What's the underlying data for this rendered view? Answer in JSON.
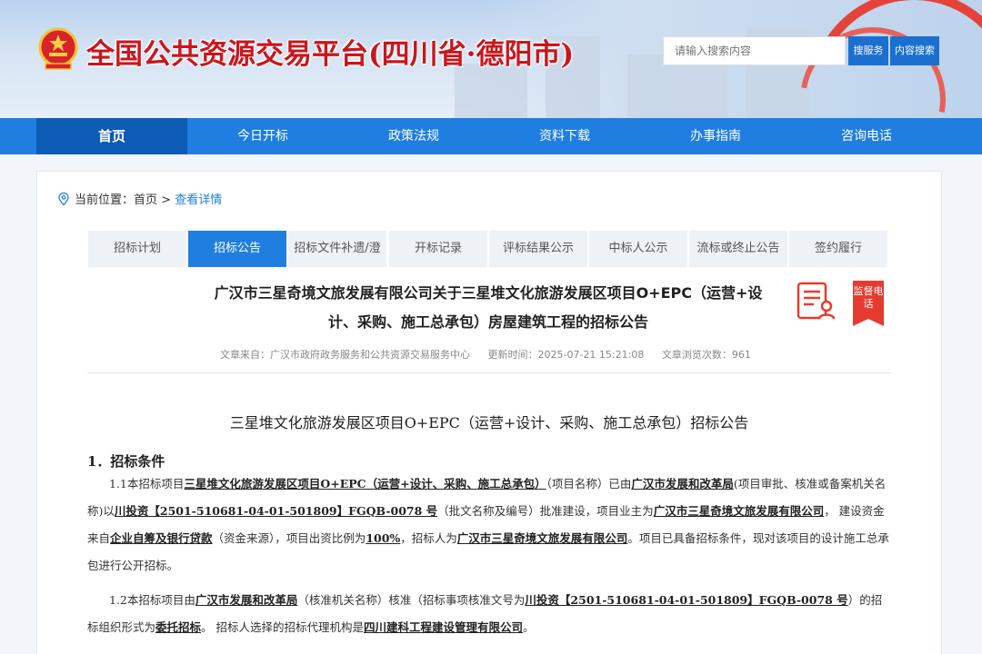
{
  "site": {
    "title": "全国公共资源交易平台(四川省·德阳市)",
    "search_placeholder": "请输入搜索内容",
    "search_service_label": "搜服务",
    "search_content_label": "内容搜索"
  },
  "nav": {
    "items": [
      "首页",
      "今日开标",
      "政策法规",
      "资料下载",
      "办事指南",
      "咨询电话"
    ],
    "active_index": 0
  },
  "breadcrumb": {
    "prefix": "当前位置：",
    "home": "首页",
    "separator": " > ",
    "current": "查看详情"
  },
  "tabs": {
    "items": [
      "招标计划",
      "招标公告",
      "招标文件补遗/澄",
      "开标记录",
      "评标结果公示",
      "中标人公示",
      "流标或终止公告",
      "签约履行"
    ],
    "active_index": 1
  },
  "article": {
    "title": "广汉市三星奇境文旅发展有限公司关于三星堆文化旅游发展区项目O+EPC（运营+设计、采购、施工总承包）房屋建筑工程的招标公告",
    "source": "文章来自：广汉市政府政务服务和公共资源交易服务中心",
    "updated": "更新时间：2025-07-21 15:21:08",
    "views": "文章浏览次数：961",
    "supervise_badge": "监督电话"
  },
  "doc": {
    "title": "三星堆文化旅游发展区项目O+EPC（运营+设计、采购、施工总承包）招标公告",
    "section1": "1．招标条件",
    "p1": {
      "t1": "1.1本招标项目",
      "project": "三星堆文化旅游发展区项目O+EPC（运营+设计、采购、施工总承包）",
      "t2": "（项目名称）已由",
      "approver": "广汉市发展和改革局",
      "t3": "(项目审批、核准或备案机关名称)以",
      "doc_no": "川投资【2501-510681-04-01-501809】FGQB-0078 号",
      "t4": "（批文名称及编号）批准建设，项目业主为",
      "owner": "广汉市三星奇境文旅发展有限公司",
      "t5": "， 建设资金来自",
      "funding": "企业自筹及银行贷款",
      "t6": "（资金来源），项目出资比例为",
      "ratio": "100%",
      "t7": "，招标人为",
      "tenderer": "广汉市三星奇境文旅发展有限公司",
      "t8": "。项目已具备招标条件，现对该项目的设计施工总承包进行公开招标。"
    },
    "p2": {
      "t1": "1.2本招标项目由",
      "approver": "广汉市发展和改革局",
      "t2": "（核准机关名称）核准（招标事项核准文号为",
      "doc_no": "川投资【2501-510681-04-01-501809】FGQB-0078 号",
      "t3": "）的招标组织形式为",
      "form": "委托招标",
      "t4": "。 招标人选择的招标代理机构是",
      "agency": "四川建科工程建设管理有限公司",
      "t5": "。"
    }
  },
  "colors": {
    "nav_bg": "#1f7ee0",
    "nav_active": "#0c5bb5",
    "title_red": "#c9161d",
    "badge_red": "#e53b2f"
  }
}
